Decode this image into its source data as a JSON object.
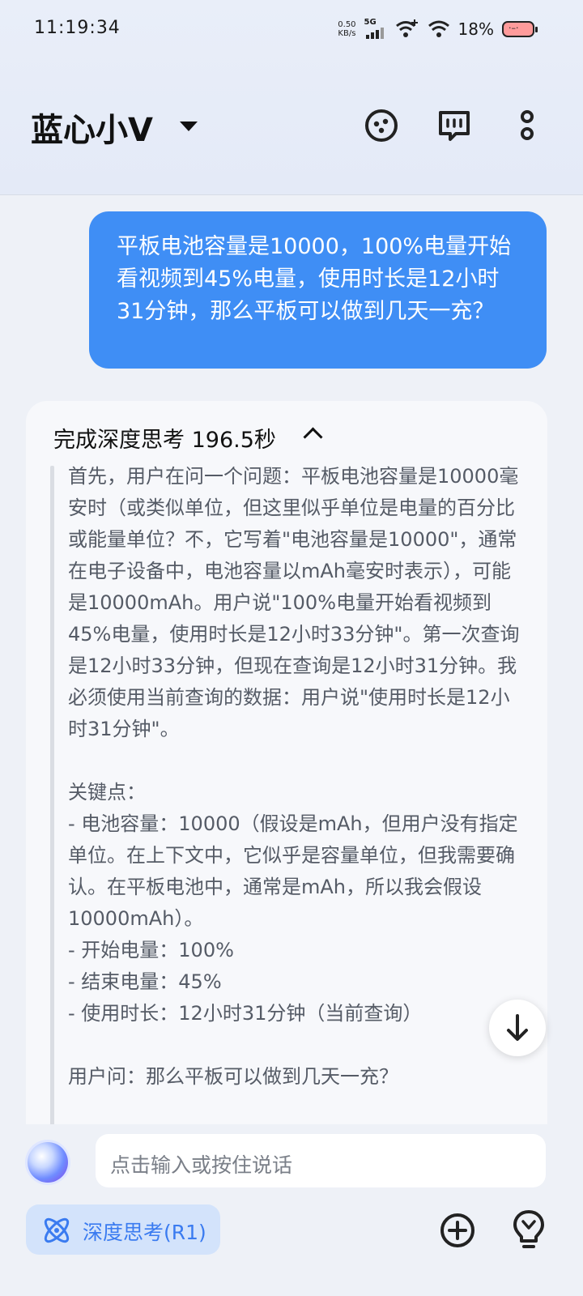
{
  "status_bar": {
    "time": "11:19:34",
    "net_speed_value": "0.50",
    "net_speed_unit": "KB/s",
    "signal_label": "5G",
    "battery_percent": "18%"
  },
  "header": {
    "title": "蓝心小V"
  },
  "chat": {
    "user_message": "平板电池容量是10000，100%电量开始看视频到45%电量，使用时长是12小时31分钟，那么平板可以做到几天一充？",
    "thinking_title": "完成深度思考 196.5秒",
    "thinking_paragraphs": [
      "首先，用户在问一个问题：平板电池容量是10000毫安时（或类似单位，但这里似乎单位是电量的百分比或能量单位？不，它写着\"电池容量是10000\"，通常在电子设备中，电池容量以mAh毫安时表示），可能是10000mAh。用户说\"100%电量开始看视频到45%电量，使用时长是12小时33分钟\"。第一次查询是12小时33分钟，但现在查询是12小时31分钟。我必须使用当前查询的数据：用户说\"使用时长是12小时31分钟\"。",
      "",
      "关键点：",
      "- 电池容量：10000（假设是mAh，但用户没有指定单位。在上下文中，它似乎是容量单位，但我需要确认。在平板电池中，通常是mAh，所以我会假设10000mAh）。",
      "- 开始电量：100%",
      "- 结束电量：45%",
      "- 使用时长：12小时31分钟（当前查询）",
      "",
      "用户问：那么平板可以做到几天一充？"
    ]
  },
  "composer": {
    "placeholder": "点击输入或按住说话",
    "deep_think_label": "深度思考(R1)"
  }
}
